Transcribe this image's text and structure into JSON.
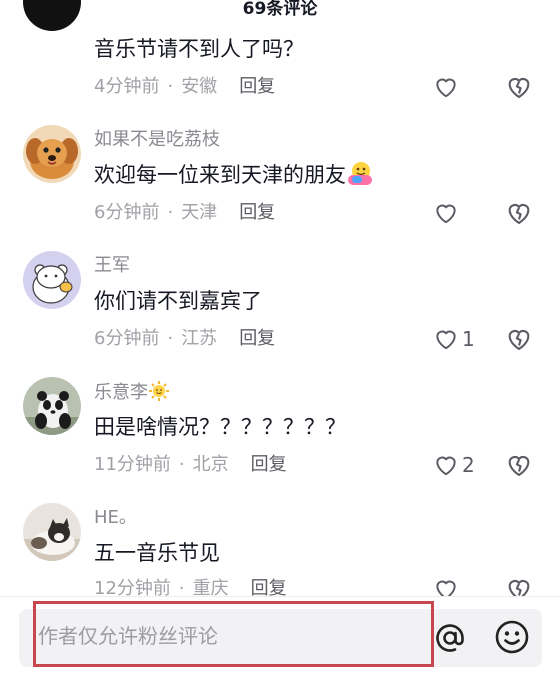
{
  "header": {
    "title": "69条评论"
  },
  "comments": [
    {
      "username": "",
      "text": "音乐节请不到人了吗？",
      "time": "4分钟前",
      "location": "安徽",
      "reply_label": "回复",
      "like_count": "",
      "avatar_icon": "black-avatar-icon"
    },
    {
      "username": "如果不是吃荔枝",
      "text": "欢迎每一位来到天津的朋友",
      "emoji": "hug-emoji-icon",
      "time": "6分钟前",
      "location": "天津",
      "reply_label": "回复",
      "like_count": "",
      "avatar_icon": "dog-avatar-icon"
    },
    {
      "username": "王军",
      "text": "你们请不到嘉宾了",
      "time": "6分钟前",
      "location": "江苏",
      "reply_label": "回复",
      "like_count": "1",
      "avatar_icon": "cartoon-bear-avatar-icon"
    },
    {
      "username": "乐意李",
      "username_emoji": "sun-emoji-icon",
      "text": "田是啥情况？？？？？？？",
      "time": "11分钟前",
      "location": "北京",
      "reply_label": "回复",
      "like_count": "2",
      "avatar_icon": "panda-avatar-icon"
    },
    {
      "username": "HE。",
      "text": "五一音乐节见",
      "time": "12分钟前",
      "location": "重庆",
      "reply_label": "回复",
      "like_count": "",
      "avatar_icon": "cat-avatar-icon"
    }
  ],
  "meta_separator": "·",
  "input": {
    "placeholder": "作者仅允许粉丝评论"
  },
  "colors": {
    "highlight": "#c8474f",
    "text": "#161823",
    "muted": "#a1a2a7"
  }
}
